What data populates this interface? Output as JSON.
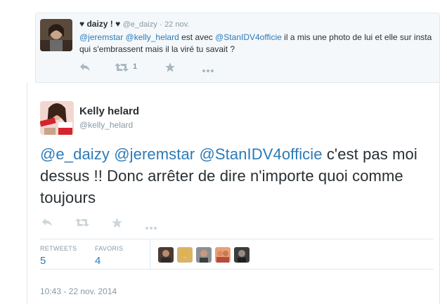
{
  "reply_tweet": {
    "name": "♥ daizy ! ♥",
    "handle": "@e_daizy",
    "separator": "·",
    "date": "22 nov.",
    "text_parts": [
      {
        "text": "@jeremstar",
        "mention": true
      },
      {
        "text": " ",
        "mention": false
      },
      {
        "text": "@kelly_helard",
        "mention": true
      },
      {
        "text": " est avec ",
        "mention": false
      },
      {
        "text": "@StanIDV4officie",
        "mention": true
      },
      {
        "text": " il a mis une photo de lui et elle sur insta qui s'embrassent mais il la viré tu savait ?",
        "mention": false
      }
    ],
    "retweet_count": "1",
    "icons": [
      "reply-icon",
      "retweet-icon",
      "favorite-icon",
      "more-icon"
    ]
  },
  "main_tweet": {
    "name": "Kelly helard",
    "handle": "@kelly_helard",
    "text_parts": [
      {
        "text": "@e_daizy",
        "mention": true
      },
      {
        "text": " ",
        "mention": false
      },
      {
        "text": "@jeremstar",
        "mention": true
      },
      {
        "text": " ",
        "mention": false
      },
      {
        "text": "@StanIDV4officie",
        "mention": true
      },
      {
        "text": " c'est pas moi dessus !! Donc arrêter de dire n'importe quoi comme toujours",
        "mention": false
      }
    ],
    "icons": [
      "reply-icon",
      "retweet-icon",
      "favorite-icon",
      "more-icon"
    ],
    "stats": {
      "retweets_label": "RETWEETS",
      "retweets_value": "5",
      "favorites_label": "FAVORIS",
      "favorites_value": "4"
    },
    "timestamp": "10:43 - 22 nov. 2014"
  },
  "colors": {
    "link": "#2b7bb9",
    "muted": "#8899a6",
    "text": "#292f33",
    "border": "#e1e8ed",
    "reply_bg": "#f5f8fa"
  }
}
